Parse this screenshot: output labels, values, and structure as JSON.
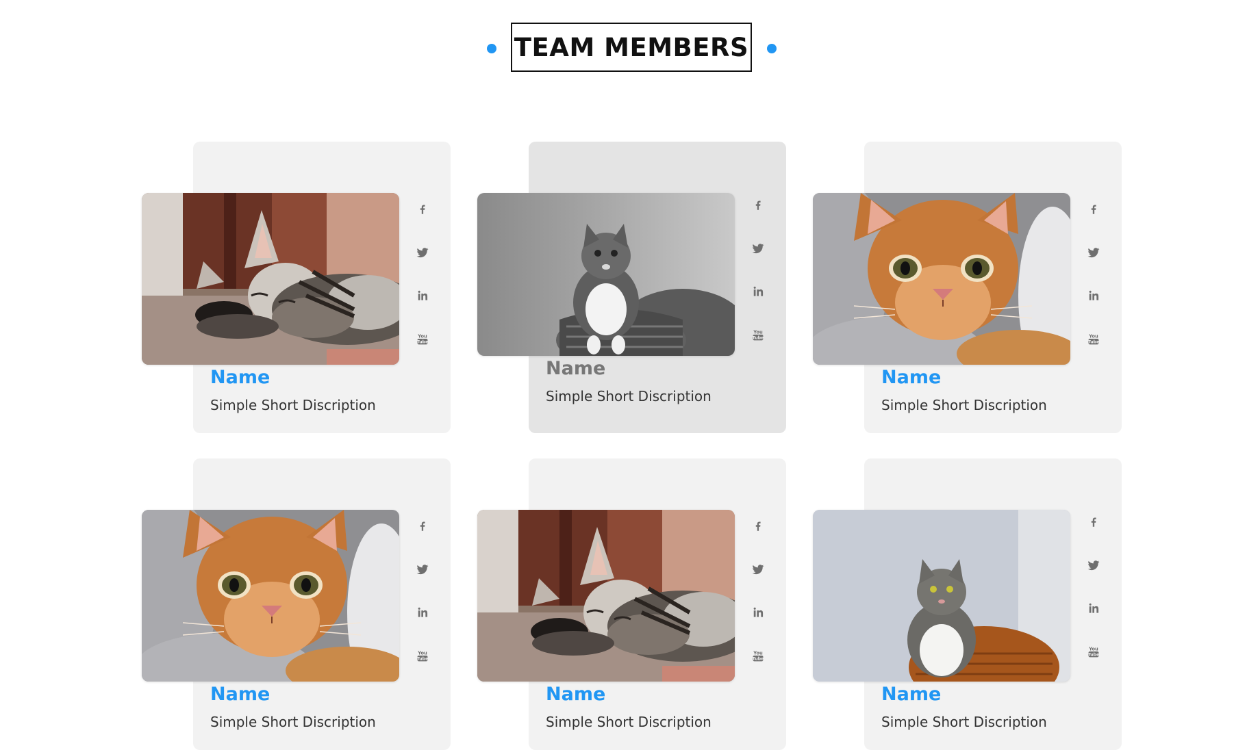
{
  "section": {
    "title": "TEAM MEMBERS",
    "accent_color": "#2196f3"
  },
  "members": [
    {
      "name": "Name",
      "description": "Simple Short Discription",
      "photo": "sleeping-tabby-kitten",
      "state": "default",
      "social": [
        "facebook-icon",
        "twitter-icon",
        "linkedin-icon",
        "youtube-icon"
      ]
    },
    {
      "name": "Name",
      "description": "Simple Short Discription",
      "photo": "grayscale-cat-in-basket",
      "state": "hover",
      "social": [
        "facebook-icon",
        "twitter-icon",
        "linkedin-icon",
        "youtube-icon"
      ]
    },
    {
      "name": "Name",
      "description": "Simple Short Discription",
      "photo": "orange-kitten-in-blanket",
      "state": "default",
      "social": [
        "facebook-icon",
        "twitter-icon",
        "linkedin-icon",
        "youtube-icon"
      ]
    },
    {
      "name": "Name",
      "description": "Simple Short Discription",
      "photo": "orange-kitten-in-blanket",
      "state": "default",
      "social": [
        "facebook-icon",
        "twitter-icon",
        "linkedin-icon",
        "youtube-icon"
      ]
    },
    {
      "name": "Name",
      "description": "Simple Short Discription",
      "photo": "sleeping-tabby-kitten",
      "state": "default",
      "social": [
        "facebook-icon",
        "twitter-icon",
        "linkedin-icon",
        "youtube-icon"
      ]
    },
    {
      "name": "Name",
      "description": "Simple Short Discription",
      "photo": "gray-cat-in-basket",
      "state": "default",
      "social": [
        "facebook-icon",
        "twitter-icon",
        "linkedin-icon",
        "youtube-icon"
      ]
    }
  ]
}
